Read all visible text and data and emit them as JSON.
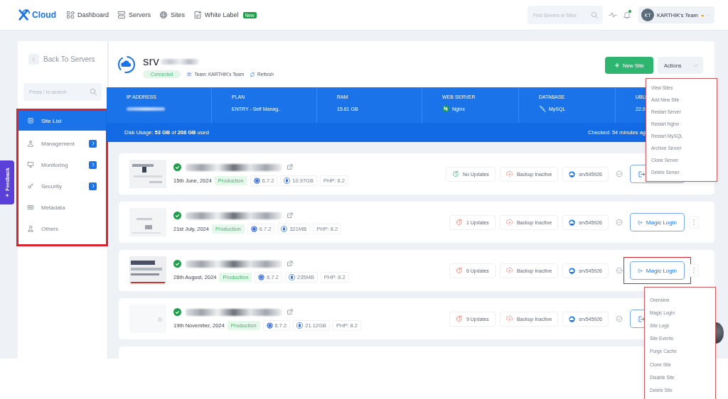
{
  "nav": {
    "logo": "Cloud",
    "items": [
      {
        "label": "Dashboard"
      },
      {
        "label": "Servers"
      },
      {
        "label": "Sites"
      },
      {
        "label": "White Label",
        "badge": "New"
      }
    ],
    "search": {
      "placeholder": "Find Servers or Sites"
    },
    "notification_dot": true,
    "team": {
      "avatar": "KT",
      "name": "KARTHIK's Team"
    }
  },
  "feedback_tab": {
    "label": "Feedback"
  },
  "sidebar": {
    "back": "Back To Servers",
    "search": {
      "placeholder": "Press / to search"
    },
    "highlighted": true,
    "items": [
      {
        "label": "Site List",
        "selected": true,
        "expandable": false
      },
      {
        "label": "Management",
        "selected": false,
        "expandable": true
      },
      {
        "label": "Monitoring",
        "selected": false,
        "expandable": true
      },
      {
        "label": "Security",
        "selected": false,
        "expandable": true
      },
      {
        "label": "Metadata",
        "selected": false,
        "expandable": false
      },
      {
        "label": "Others",
        "selected": false,
        "expandable": false
      }
    ]
  },
  "server": {
    "name": "srv",
    "status": "Connected",
    "team": "Team: KARTHIK's Team",
    "refresh": "Refresh",
    "new_site": "New Site",
    "actions": "Actions",
    "info": [
      {
        "label": "IP ADDRESS",
        "redacted": true
      },
      {
        "label": "PLAN",
        "value": "ENTRY - Self Manag.."
      },
      {
        "label": "RAM",
        "value": "15.61 GB"
      },
      {
        "label": "WEB SERVER",
        "value": "Nginx"
      },
      {
        "label": "DATABASE",
        "value": "MySQL"
      },
      {
        "label": "UBU",
        "value": "22.0"
      }
    ],
    "disk_usage": "Disk Usage: **53 GB** of **208 GB** used",
    "checked": "Checked: 54 minutes ag"
  },
  "sites": [
    {
      "date": "15th June, 2024",
      "environment": "Production",
      "wp": "6.7.2",
      "size": "10.97GB",
      "php": "PHP: 8.2",
      "updates": "No Updates",
      "updates_pending": false,
      "backup": "Backup Inactive",
      "server": "srv545926",
      "login_button": {
        "highlighted": false
      },
      "menu_button": false
    },
    {
      "date": "21st July, 2024",
      "environment": "Production",
      "wp": "6.7.2",
      "size": "321MB",
      "php": "PHP: 8.2",
      "updates": "1 Updates",
      "updates_pending": true,
      "backup": "Backup Inactive",
      "server": "srv545926",
      "login_button": {
        "label": "Magic Login",
        "highlighted": false
      },
      "menu_button": true
    },
    {
      "date": "26th August, 2024",
      "environment": "Production",
      "wp": "6.7.2",
      "size": "235MB",
      "php": "PHP: 8.2",
      "updates": "6 Updates",
      "updates_pending": true,
      "backup": "Backup Inactive",
      "server": "srv545926",
      "login_button": {
        "label": "Magic Login",
        "highlighted": true
      },
      "menu_button": true
    },
    {
      "date": "19th November, 2024",
      "environment": "Production",
      "wp": "6.7.2",
      "size": "21.12GB",
      "php": "PHP: 8.2",
      "updates": "9 Updates",
      "updates_pending": true,
      "backup": "Backup Inactive",
      "server": "srv545926",
      "login_button": {
        "highlighted": false
      },
      "menu_button": false
    }
  ],
  "actions_menu": {
    "highlighted": true,
    "items": [
      "View Sites",
      "Add New Site",
      "Restart Server",
      "Restart Nginx",
      "Restart MySQL",
      "Archive Server",
      "Clone Server",
      "Delete Server"
    ]
  },
  "site_menu": {
    "highlighted": true,
    "items": [
      "Overview",
      "Magic Login",
      "Site Logs",
      "Site Events",
      "Purge Cache",
      "Clone Site",
      "Disable Site",
      "Delete Site"
    ]
  }
}
